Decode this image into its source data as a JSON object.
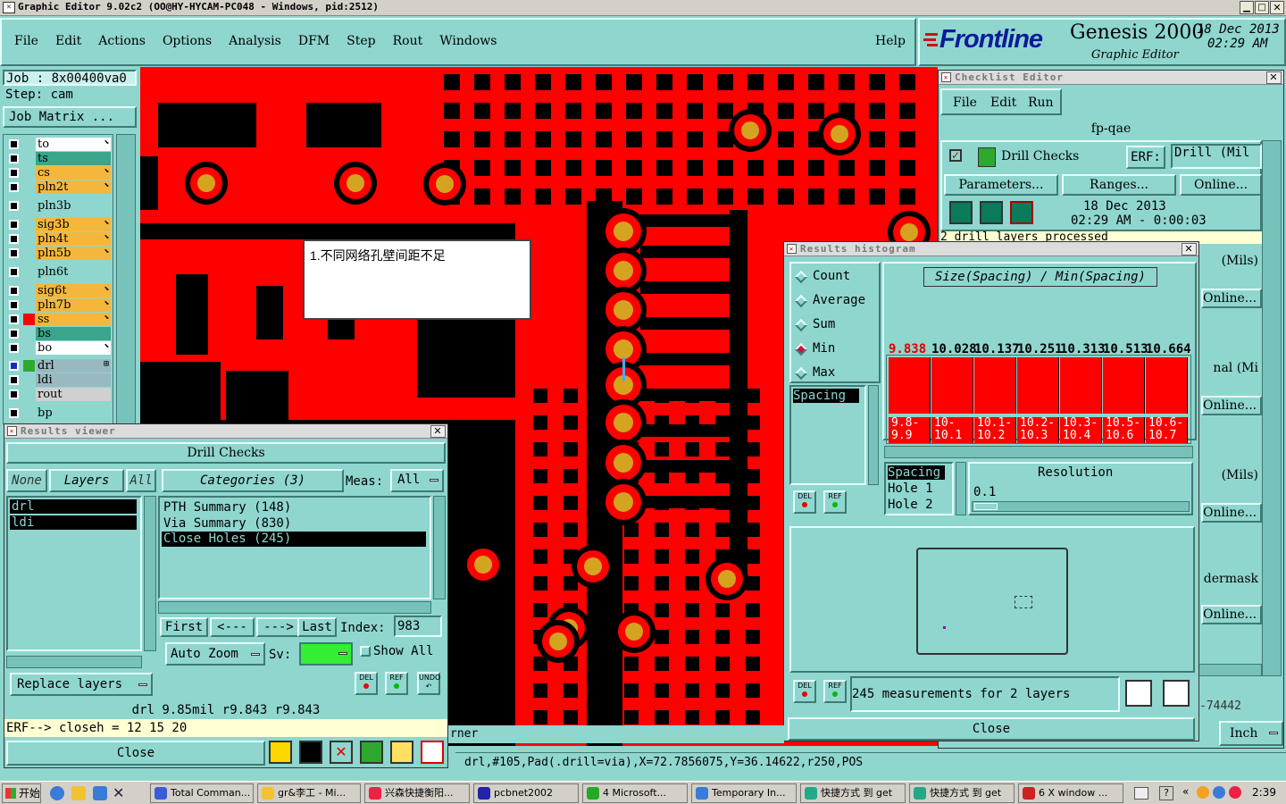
{
  "titlebar": {
    "title": "Graphic Editor 9.02c2 (OO@HY-HYCAM-PC048 - Windows, pid:2512)"
  },
  "menu": {
    "items": [
      "File",
      "Edit",
      "Actions",
      "Options",
      "Analysis",
      "DFM",
      "Step",
      "Rout",
      "Windows"
    ],
    "help": "Help"
  },
  "brand": {
    "logo": "Frontline",
    "product": "Genesis 2000",
    "subtitle": "Graphic Editor",
    "date": "18 Dec 2013",
    "time": "02:29 AM"
  },
  "job": {
    "job": "Job : 8x00400va0",
    "step": "Step: cam",
    "matrix_button": "Job Matrix ..."
  },
  "layers": [
    {
      "name": "to",
      "color": "#ffffff",
      "arrow": "⬊"
    },
    {
      "name": "ts",
      "color": "#3aa58a",
      "arrow": ""
    },
    {
      "name": "cs",
      "color": "#f4b73c",
      "arrow": "⬊"
    },
    {
      "name": "pln2t",
      "color": "#f4b73c",
      "arrow": "⬊"
    },
    {
      "name": "pln3b",
      "color": "#8fd6cf",
      "arrow": ""
    },
    {
      "name": "sig3b",
      "color": "#f4b73c",
      "arrow": "⬊"
    },
    {
      "name": "pln4t",
      "color": "#f4b73c",
      "arrow": "⬊"
    },
    {
      "name": "pln5b",
      "color": "#f4b73c",
      "arrow": "⬊"
    },
    {
      "name": "pln6t",
      "color": "#8fd6cf",
      "arrow": ""
    },
    {
      "name": "sig6t",
      "color": "#f4b73c",
      "arrow": "⬊"
    },
    {
      "name": "pln7b",
      "color": "#f4b73c",
      "arrow": "⬊"
    },
    {
      "name": "ss",
      "color": "#f4b73c",
      "arrow": "⬊"
    },
    {
      "name": "bs",
      "color": "#3aa58a",
      "arrow": ""
    },
    {
      "name": "bo",
      "color": "#ffffff",
      "arrow": "⬊"
    },
    {
      "name": "drl",
      "color": "#9ab8bf",
      "arrow": "⊞"
    },
    {
      "name": "ldi",
      "color": "#9ab8bf",
      "arrow": ""
    },
    {
      "name": "rout",
      "color": "#d0d0d0",
      "arrow": ""
    },
    {
      "name": "bp",
      "color": "#8fd6cf",
      "arrow": ""
    }
  ],
  "annotation": {
    "text": "1.不同网络孔壁间距不足"
  },
  "results_viewer": {
    "title": "Results viewer",
    "header": "Drill Checks",
    "none_label": "None",
    "layers_label": "Layers",
    "all_label": "All",
    "categories_label": "Categories (3)",
    "meas_label": "Meas:",
    "meas_value": "All",
    "layer_list": [
      "drl",
      "ldi"
    ],
    "categories": [
      "PTH Summary (148)",
      "Via Summary (830)",
      "Close Holes (245)"
    ],
    "nav": {
      "first": "First",
      "prev": "<---",
      "next": "--->",
      "last": "Last",
      "index_label": "Index:",
      "index_value": "983"
    },
    "auto_zoom": "Auto Zoom",
    "sv_label": "Sv:",
    "show_all": "Show All",
    "replace_layers": "Replace layers",
    "readout": "drl 9.85mil  r9.843  r9.843",
    "erf": "ERF--> closeh = 12 15 20",
    "close": "Close",
    "icons": {
      "del": "DEL",
      "ref": "REF",
      "undo": "UNDO"
    }
  },
  "checklist": {
    "title": "Checklist Editor",
    "menu": [
      "File",
      "Edit",
      "Run"
    ],
    "name": "fp-qae",
    "action": "Drill Checks",
    "erf_label": "ERF:",
    "erf_value": "Drill (Mil",
    "parameters": "Parameters...",
    "ranges": "Ranges...",
    "online": "Online...",
    "date": "18 Dec 2013",
    "time": "02:29 AM - 0:00:03",
    "status": "2 drill layers processed",
    "side_labels": [
      "(Mils)",
      "Online...",
      "nal (Mi",
      "Online...",
      "(Mils)",
      "Online...",
      "dermask",
      "Online..."
    ],
    "footer_partial": "-74442",
    "inch": "Inch"
  },
  "histogram": {
    "title": "Results histogram",
    "modes": [
      "Count",
      "Average",
      "Sum",
      "Min",
      "Max"
    ],
    "selected_mode": "Min",
    "chart_title": "Size(Spacing) / Min(Spacing)",
    "values": [
      "9.838",
      "10.028",
      "10.137",
      "10.251",
      "10.313",
      "10.513",
      "10.664"
    ],
    "bins": [
      "9.8-\n9.9",
      "10-\n10.1",
      "10.1-\n10.2",
      "10.2-\n10.3",
      "10.3-\n10.4",
      "10.5-\n10.6",
      "10.6-\n10.7"
    ],
    "list_top": [
      "Spacing"
    ],
    "list_bottom": [
      "Spacing",
      "Hole 1",
      "Hole 2"
    ],
    "resolution_label": "Resolution",
    "resolution_value": "0.1",
    "summary": "245 measurements for 2 layers",
    "close": "Close"
  },
  "status": {
    "partial": "rner",
    "coords": "drl,#105,Pad(.drill=via),X=72.7856075,Y=36.14622,r250,POS"
  },
  "taskbar": {
    "start": "开始",
    "items": [
      "Total Comman...",
      "gr&李工 - Mi...",
      "兴森快捷衡阳...",
      "pcbnet2002",
      "4 Microsoft...",
      "Temporary In...",
      "快捷方式 到 get",
      "快捷方式 到 get",
      "6 X window ..."
    ],
    "clock": "2:39"
  },
  "colors": {
    "bg": "#8fd6cf",
    "pcb_red": "#ff0000",
    "pad_gold": "#d4a420",
    "select_green": "#33ee33"
  }
}
